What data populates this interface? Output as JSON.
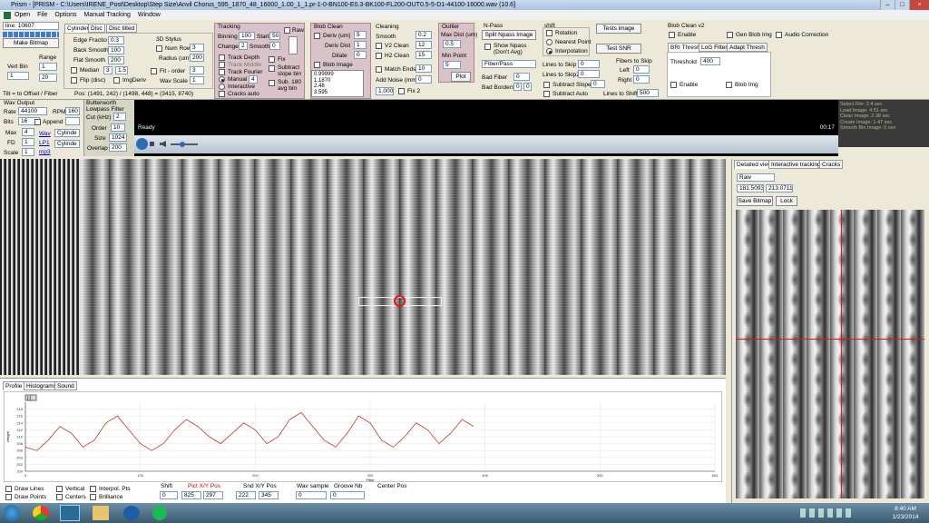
{
  "window": {
    "title": "Prism - [PRISM - C:\\Users\\IRENE_Post\\Desktop\\Step Size\\Anvil Chorus_595_1870_48_16000_1.00_1_1.pr-1-0-BN100-E0.3-BK100-FL200-OUT0.5-5-D1-44100-16000.wav (10.6]",
    "min": "–",
    "max": "□",
    "close": "×"
  },
  "menu": [
    "Open",
    "File",
    "Options",
    "Manual Tracking",
    "Window"
  ],
  "left": {
    "line": "line: 10607",
    "make_bitmap": "Make Bitmap",
    "vert_bin_label": "Vert Bin",
    "vert_bin_value": "1",
    "range_label": "Range",
    "range_min": "1",
    "range_max": "20"
  },
  "tabs_top": [
    "Cylinder",
    "Disc",
    "Disc tilted"
  ],
  "cylinder": {
    "edge_fractio_label": "Edge Fractio",
    "edge_fractio": "0.3",
    "back_smooth_label": "Back Smooth",
    "back_smooth": "100",
    "flat_smooth_label": "Flat Smooth",
    "flat_smooth": "200",
    "median_label": "Median",
    "median_a": "3",
    "median_b": "1.5",
    "flip_label": "Flip (disc)",
    "imgderiv_label": "ImgDeriv",
    "stylus_label": "3D Stylus",
    "num_row_label": "Num Row",
    "num_row": "3",
    "radius_label": "Radius (um)",
    "radius": "200",
    "fit_order_label": "Fit - order",
    "fit_order": "3",
    "wav_scale_label": "Wav Scale",
    "wav_scale": "1"
  },
  "tilt_line": "Tilt = to Offset / Fiber",
  "pos_line": "Pos: (1491, 242) / (1498, 448) = (3415, 8740)",
  "tracking": {
    "title": "Tracking",
    "binning_label": "Binning",
    "binning": "100",
    "start_label": "Start",
    "start": "50",
    "raw_label": "Raw",
    "change_label": "Change",
    "change": "2",
    "smooth_label": "Smooth",
    "smooth": "0",
    "track_depth": "Track Depth",
    "track_middle": "Track Middle",
    "track_fourier": "Track Fourier",
    "manual": "Manual",
    "manual_val": "4",
    "interactive": "Interactive",
    "cracks_auto": "Cracks auto",
    "fix": "Fix",
    "subtract_slope_bin": "Subtract slope bin",
    "sub_180": "Sub. 180 avg bin"
  },
  "blob": {
    "title": "Blob Clean",
    "deriv_um_label": "Deriv (um)",
    "deriv_um": "5",
    "deriv_dist_label": "Deriv Dist",
    "deriv_dist": "1",
    "dilate_label": "Dilate",
    "dilate": "0",
    "blob_image_label": "Blob Image",
    "list": [
      "0.99999",
      "1.1870",
      "2.48",
      "3.595"
    ]
  },
  "cleaning": {
    "title": "Cleaning",
    "smooth_label": "Smooth",
    "smooth": "0.2",
    "v2_label": "V2 Clean",
    "v2": "12",
    "h2_label": "H2 Clean",
    "h2": "15",
    "match_ends_label": "Match Ends",
    "match_ends": "10",
    "add_noise_label": "Add Noise (mm)",
    "add_noise": "0",
    "fix2_label": "Fix 2",
    "fix2_val": "1.000"
  },
  "outlier": {
    "title": "Outlier",
    "max_dist_label": "Max Dist (um)",
    "max_dist": "0.5",
    "min_point_label": "Min Point",
    "min_point": "5",
    "plot": "Plot"
  },
  "npass": {
    "title": "N-Pass",
    "split": "Split Npass Image",
    "show": "Show Npass (Don't Avg)",
    "fiber_pass": "Fiber/Pass",
    "bad_fiber_label": "Bad Fiber",
    "bad_fiber": "0",
    "bad_borders_label": "Bad Borders",
    "bad_a": "0",
    "bad_b": "0"
  },
  "shift": {
    "title": "shift",
    "rotation": "Rotation",
    "nearest": "Nearest Point",
    "interp": "Interpolation",
    "lines_skip_label": "Lines to Skip",
    "lines_skip": "0",
    "lines_skip2_label": "Lines to Skip2",
    "lines_skip2": "0",
    "sub_slope": "Subtract Slope",
    "sub_slope_val": "0",
    "sub_auto": "Subtract Auto"
  },
  "tests": {
    "tests_image": "Tests image",
    "test_snr": "Test SNR",
    "fibers_label": "Fibers to Skip",
    "left_label": "Left",
    "left": "0",
    "right_label": "Right",
    "right": "0",
    "lines_shift_label": "Lines to Shift",
    "lines_shift": "500"
  },
  "blob2": {
    "title": "Blob Clean v2",
    "enable": "Enable",
    "gen_blob": "Gen Blob Img",
    "tabs": [
      "BRI Thresh",
      "LoG Filter",
      "Adapt Thresh"
    ],
    "threshold_label": "Threshold",
    "threshold": "400",
    "enable2": "Enable",
    "blob_img": "Blob Img",
    "audio": "Audio Correction"
  },
  "wav": {
    "title": "Wav Output",
    "rate_label": "Rate",
    "rate": "44100",
    "rpm_label": "RPM",
    "rpm": "160",
    "bits_label": "Bits",
    "bits": "16",
    "append": "Append",
    "max_label": "Max",
    "max": "4",
    "fd_label": "FD",
    "fd": "1",
    "scale_label": "Scale",
    "scale": "1",
    "wav_link": "Wav",
    "lp1_link": "LP1",
    "mp3_link": "mp3",
    "cyl1": "Cylinde",
    "cyl2": "Cylinde"
  },
  "butter": {
    "title": "Butterworth Lowpass Filter",
    "cut_label": "Cut (kHz)",
    "cut": "2",
    "order_label": "Order",
    "order": "10",
    "size_label": "Size",
    "size": "1024",
    "overlap_label": "Overlap",
    "overlap": "200"
  },
  "transport": {
    "status": "Ready",
    "time": "00:17"
  },
  "stats": [
    "Select File: 2.4 sec",
    "Load Image: 4.51 sec",
    "Clean Image: 2.38 sec",
    "Create Image: 1.47 sec",
    "Smooth Bin Image: 0 sec"
  ],
  "bottom_tabs": [
    "Profile",
    "Histograms",
    "Sound"
  ],
  "profile_chart_mini_label": "[-]",
  "chart_data": {
    "type": "line",
    "x": [
      0,
      10,
      20,
      30,
      40,
      50,
      60,
      70,
      80,
      90,
      100,
      110,
      120,
      130,
      140,
      150,
      160,
      170,
      180,
      190,
      200,
      210,
      220,
      230,
      240,
      250,
      260,
      270,
      280,
      290,
      300,
      310,
      320,
      330,
      340,
      350,
      360,
      370,
      380,
      390
    ],
    "series": [
      {
        "values": [
          207,
          206,
          209,
          213,
          211,
          207,
          209,
          214,
          216,
          212,
          208,
          206,
          208,
          212,
          215,
          213,
          210,
          208,
          211,
          214,
          212,
          208,
          210,
          215,
          217,
          213,
          209,
          207,
          211,
          216,
          214,
          209,
          207,
          210,
          214,
          212,
          208,
          211,
          215,
          213
        ]
      }
    ],
    "xlabel": "Fiber",
    "ylabel": "Height",
    "xlim": [
      0,
      400
    ],
    "ylim": [
      200,
      220
    ],
    "xticks": [
      "0",
      "100",
      "200",
      "300",
      "400",
      "500",
      "600"
    ],
    "yticks": [
      "218",
      "216",
      "214",
      "212",
      "210",
      "208",
      "206",
      "204",
      "202",
      "200"
    ],
    "line_color": "#c0392b",
    "grid": true
  },
  "profile_controls": {
    "draw_lines": "Draw Lines",
    "draw_points": "Draw Points",
    "vertical": "Vertical",
    "centers": "Centers",
    "interpol": "Interpol. Pts",
    "brilliance": "Brilliance",
    "shift_label": "Shift",
    "shift_val": "0",
    "pict_label": "Pict X/Y Pos",
    "pict_x": "825",
    "pict_y": "297",
    "snd_label": "Snd X/Y Pos",
    "snd_x": "222",
    "snd_y": "345",
    "wav_sample_label": "Wav sample",
    "wav_sample": "0",
    "groove_label": "Groove Nb",
    "groove": "0",
    "center_label": "Center Pos"
  },
  "right": {
    "tabs": [
      "Detailed view",
      "Interactive tracking",
      "Cracks"
    ],
    "mode": "Raw",
    "val1": "181.5093",
    "val2": "213.0711",
    "save": "Save Bitmap",
    "lock": "Lock"
  },
  "taskbar": {
    "time": "8:40 AM",
    "date": "1/23/2014"
  }
}
